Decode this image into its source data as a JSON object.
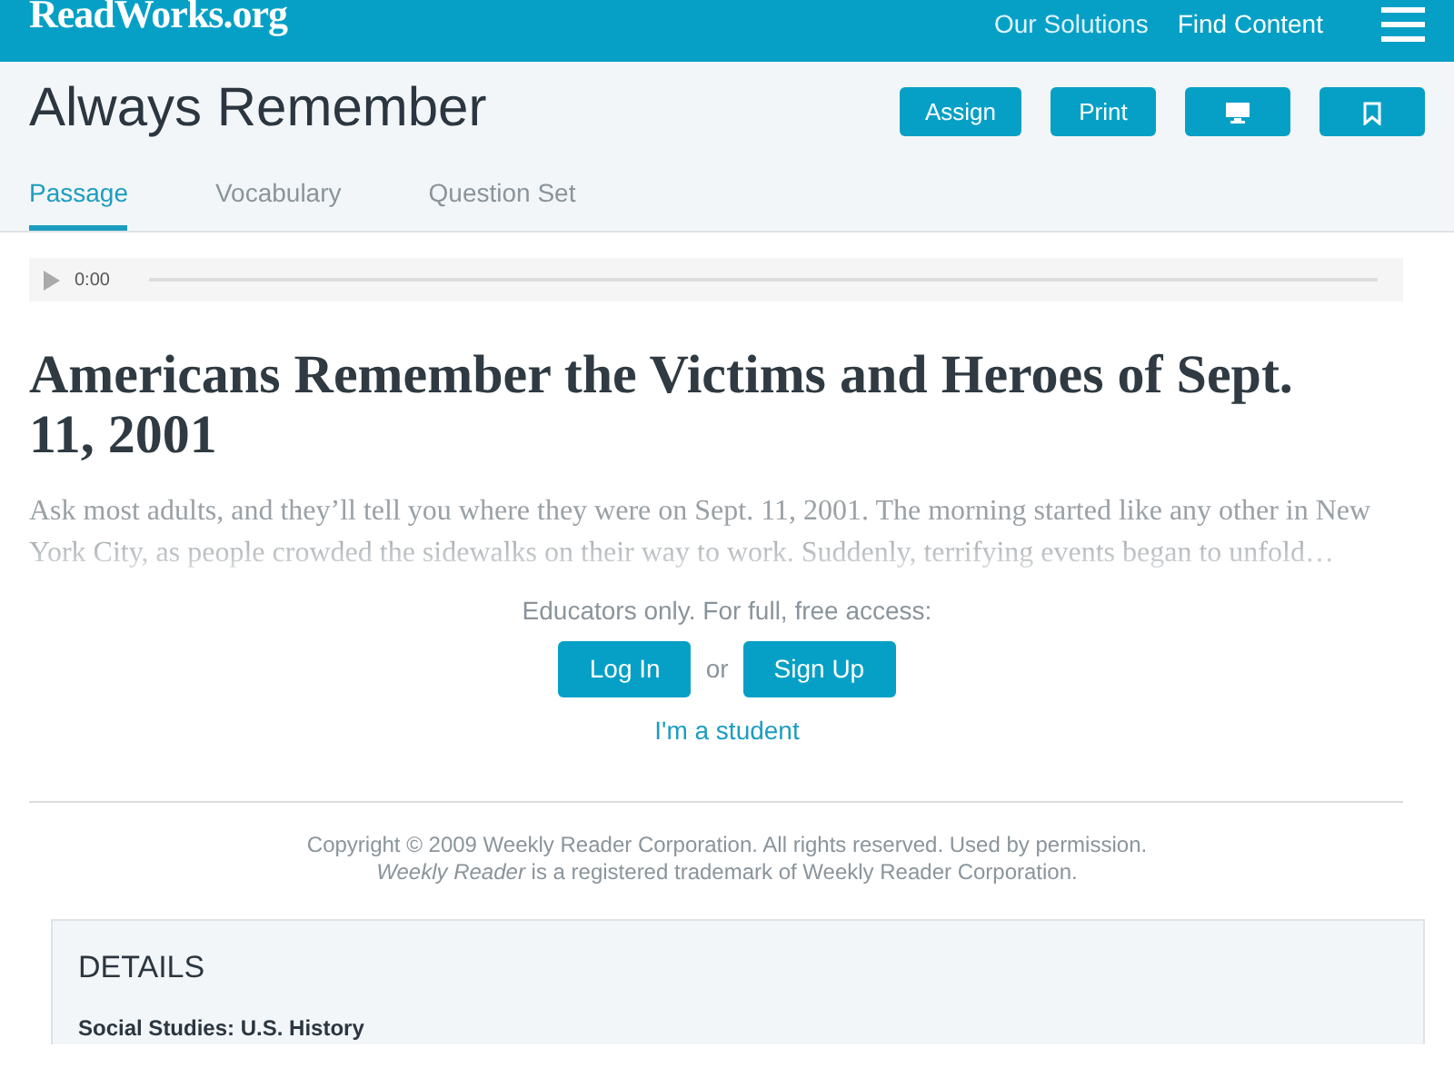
{
  "navbar": {
    "logo": "ReadWorks.org",
    "links": [
      "Our Solutions",
      "Find Content"
    ]
  },
  "header": {
    "title": "Always Remember",
    "buttons": [
      {
        "kind": "text",
        "label": "Assign"
      },
      {
        "kind": "text",
        "label": "Print"
      },
      {
        "kind": "monitor"
      },
      {
        "kind": "bookmark"
      }
    ]
  },
  "tabs": [
    {
      "label": "Passage",
      "selected": true
    },
    {
      "label": "Vocabulary",
      "selected": false
    },
    {
      "label": "Question Set",
      "selected": false
    }
  ],
  "audio": {
    "time": "0:00"
  },
  "article": {
    "title": "Americans Remember the Victims and Heroes of Sept. 11, 2001",
    "excerpt": "Ask most adults, and they’ll tell you where they were on Sept. 11, 2001. The morning started like any other in New York City, as people crowded the sidewalks on their way to work. Suddenly, terrifying events began to unfold…"
  },
  "access": {
    "prompt": "Educators only. For full, free access:",
    "login": "Log In",
    "or": "or",
    "signup": "Sign Up",
    "student": "I'm a student"
  },
  "copyright": [
    "Copyright © 2009 Weekly Reader Corporation. All rights reserved. Used by permission.",
    "*Weekly Reader* is a registered trademark of Weekly Reader Corporation."
  ],
  "details": {
    "heading": "DETAILS",
    "subject": "Social Studies: U.S. History"
  }
}
